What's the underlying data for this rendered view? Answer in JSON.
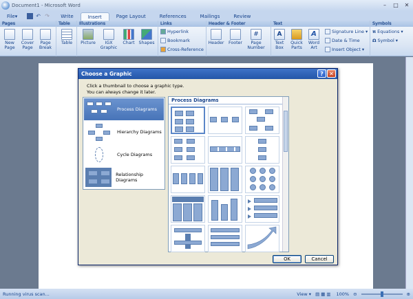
{
  "window": {
    "title": "Document1 - Microsoft Word"
  },
  "tabs": [
    "File",
    "Write",
    "Insert",
    "Page Layout",
    "References",
    "Mailings",
    "Review"
  ],
  "active_tab": "Insert",
  "ribbon": {
    "groups": {
      "pages": "Pages",
      "table": "Table",
      "illustrations": "Illustrations",
      "links": "Links",
      "header_footer": "Header & Footer",
      "text": "Text",
      "symbols": "Symbols"
    },
    "buttons": {
      "new_page": "New\nPage",
      "cover_page": "Cover\nPage",
      "page_break": "Page\nBreak",
      "table": "Table",
      "picture": "Picture",
      "igx": "IGX\nGraphic",
      "chart": "Chart",
      "shapes": "Shapes",
      "hyperlink": "Hyperlink",
      "bookmark": "Bookmark",
      "cross_reference": "Cross-Reference",
      "header": "Header",
      "footer": "Footer",
      "page_number": "Page\nNumber",
      "text_box": "Text\nBox",
      "quick_parts": "Quick\nParts",
      "word_art": "Word\nArt",
      "signature_line": "Signature Line",
      "date_time": "Date & Time",
      "insert_object": "Insert Object",
      "equations": "Equations",
      "symbol": "Symbol"
    }
  },
  "dialog": {
    "title": "Choose a Graphic",
    "desc_line1": "Click a thumbnail to choose a graphic type.",
    "desc_line2": "You can always change it later.",
    "categories": [
      "Process Diagrams",
      "Hierarchy Diagrams",
      "Cycle Diagrams",
      "Relationship Diagrams"
    ],
    "selected_category": "Process Diagrams",
    "gallery_heading": "Process Diagrams",
    "ok_label": "OK",
    "cancel_label": "Cancel"
  },
  "status": {
    "message": "Running virus scan...",
    "view_label": "View",
    "zoom": "100%"
  }
}
